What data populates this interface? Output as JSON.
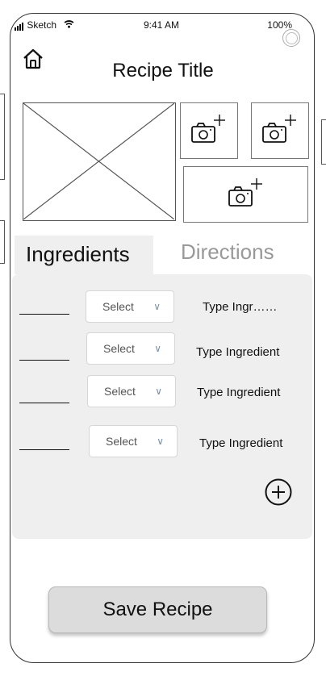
{
  "status_bar": {
    "carrier": "Sketch",
    "time": "9:41 AM",
    "battery": "100%"
  },
  "header": {
    "title": "Recipe Title",
    "home_icon": "home-icon"
  },
  "photos": {
    "add_photo_icon": "camera-plus-icon"
  },
  "tabs": [
    {
      "label": "Ingredients",
      "active": true
    },
    {
      "label": "Directions",
      "active": false
    }
  ],
  "ingredients": [
    {
      "quantity": "______",
      "select": "Select",
      "name": "Type Ingr……"
    },
    {
      "quantity": "______",
      "select": "Select",
      "name": "Type Ingredient"
    },
    {
      "quantity": "______",
      "select": "Select",
      "name": "Type Ingredient"
    },
    {
      "quantity": "______",
      "select": "Select",
      "name": "Type Ingredient"
    }
  ],
  "actions": {
    "save_label": "Save Recipe",
    "add_icon": "plus-circle-icon"
  },
  "colors": {
    "panel": "#efefef",
    "save_button": "#dcdcdc",
    "inactive_tab": "#999999"
  }
}
